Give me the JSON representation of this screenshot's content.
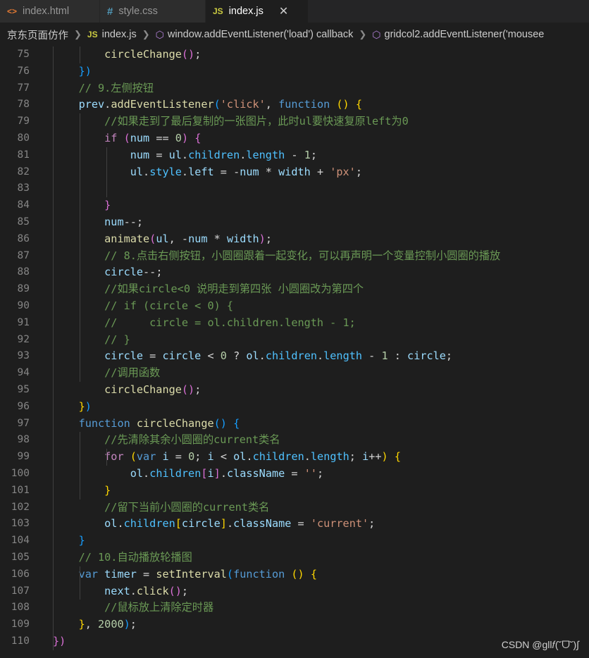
{
  "tabs": [
    {
      "label": "index.html",
      "icon": "html-icon",
      "glyph": "<>"
    },
    {
      "label": "style.css",
      "icon": "css-icon",
      "glyph": "#"
    },
    {
      "label": "index.js",
      "icon": "js-icon",
      "glyph": "JS",
      "active": true,
      "close": "✕"
    }
  ],
  "breadcrumb": {
    "folder": "京东页面仿作",
    "file": "index.js",
    "file_glyph": "JS",
    "sym1": "window.addEventListener('load') callback",
    "sym2": "gridcol2.addEventListener('mousee"
  },
  "colors": {
    "keyword": "#569cd6",
    "control": "#c586c0",
    "function": "#dcdcaa",
    "variable": "#9cdcfe",
    "string": "#ce9178",
    "number": "#b5cea8",
    "comment": "#6a9955"
  },
  "code_lines": [
    {
      "n": "75",
      "tokens": [
        [
          "        ",
          "p"
        ],
        [
          "circleChange",
          "fn"
        ],
        [
          "()",
          "b2"
        ],
        [
          ";",
          "p"
        ]
      ]
    },
    {
      "n": "76",
      "tokens": [
        [
          "    ",
          "p"
        ],
        [
          "}",
          "b3"
        ],
        [
          ")",
          "b3"
        ]
      ]
    },
    {
      "n": "77",
      "tokens": [
        [
          "    ",
          "p"
        ],
        [
          "// 9.左侧按钮",
          "cmt"
        ]
      ]
    },
    {
      "n": "78",
      "tokens": [
        [
          "    ",
          "p"
        ],
        [
          "prev",
          "var"
        ],
        [
          ".",
          "p"
        ],
        [
          "addEventListener",
          "fn"
        ],
        [
          "(",
          "b3"
        ],
        [
          "'click'",
          "str"
        ],
        [
          ", ",
          "p"
        ],
        [
          "function",
          "kw"
        ],
        [
          " ",
          "p"
        ],
        [
          "()",
          "b1"
        ],
        [
          " ",
          "p"
        ],
        [
          "{",
          "b1"
        ]
      ]
    },
    {
      "n": "79",
      "tokens": [
        [
          "        ",
          "p"
        ],
        [
          "//如果走到了最后复制的一张图片，此时ul要快速复原left为0",
          "cmt"
        ]
      ]
    },
    {
      "n": "80",
      "tokens": [
        [
          "        ",
          "p"
        ],
        [
          "if",
          "ctl"
        ],
        [
          " ",
          "p"
        ],
        [
          "(",
          "b2"
        ],
        [
          "num",
          "var"
        ],
        [
          " == ",
          "p"
        ],
        [
          "0",
          "num"
        ],
        [
          ")",
          "b2"
        ],
        [
          " ",
          "p"
        ],
        [
          "{",
          "b2"
        ]
      ]
    },
    {
      "n": "81",
      "tokens": [
        [
          "            ",
          "p"
        ],
        [
          "num",
          "var"
        ],
        [
          " = ",
          "p"
        ],
        [
          "ul",
          "var"
        ],
        [
          ".",
          "p"
        ],
        [
          "children",
          "prop"
        ],
        [
          ".",
          "p"
        ],
        [
          "length",
          "prop"
        ],
        [
          " - ",
          "p"
        ],
        [
          "1",
          "num"
        ],
        [
          ";",
          "p"
        ]
      ]
    },
    {
      "n": "82",
      "tokens": [
        [
          "            ",
          "p"
        ],
        [
          "ul",
          "var"
        ],
        [
          ".",
          "p"
        ],
        [
          "style",
          "prop"
        ],
        [
          ".",
          "p"
        ],
        [
          "left",
          "var"
        ],
        [
          " = -",
          "p"
        ],
        [
          "num",
          "var"
        ],
        [
          " * ",
          "p"
        ],
        [
          "width",
          "var"
        ],
        [
          " + ",
          "p"
        ],
        [
          "'px'",
          "str"
        ],
        [
          ";",
          "p"
        ]
      ]
    },
    {
      "n": "83",
      "tokens": []
    },
    {
      "n": "84",
      "tokens": [
        [
          "        ",
          "p"
        ],
        [
          "}",
          "b2"
        ]
      ]
    },
    {
      "n": "85",
      "tokens": [
        [
          "        ",
          "p"
        ],
        [
          "num",
          "var"
        ],
        [
          "--;",
          "p"
        ]
      ]
    },
    {
      "n": "86",
      "tokens": [
        [
          "        ",
          "p"
        ],
        [
          "animate",
          "fn"
        ],
        [
          "(",
          "b2"
        ],
        [
          "ul",
          "var"
        ],
        [
          ", -",
          "p"
        ],
        [
          "num",
          "var"
        ],
        [
          " * ",
          "p"
        ],
        [
          "width",
          "var"
        ],
        [
          ")",
          "b2"
        ],
        [
          ";",
          "p"
        ]
      ]
    },
    {
      "n": "87",
      "tokens": [
        [
          "        ",
          "p"
        ],
        [
          "// 8.点击右侧按钮，小圆圈跟着一起变化，可以再声明一个变量控制小圆圈的播放",
          "cmt"
        ]
      ]
    },
    {
      "n": "88",
      "tokens": [
        [
          "        ",
          "p"
        ],
        [
          "circle",
          "var"
        ],
        [
          "--;",
          "p"
        ]
      ]
    },
    {
      "n": "89",
      "tokens": [
        [
          "        ",
          "p"
        ],
        [
          "//如果circle<0 说明走到第四张 小圆圈改为第四个",
          "cmt"
        ]
      ]
    },
    {
      "n": "90",
      "tokens": [
        [
          "        ",
          "p"
        ],
        [
          "// if (circle < 0) {",
          "cmt"
        ]
      ]
    },
    {
      "n": "91",
      "tokens": [
        [
          "        ",
          "p"
        ],
        [
          "//     circle = ol.children.length - 1;",
          "cmt"
        ]
      ]
    },
    {
      "n": "92",
      "tokens": [
        [
          "        ",
          "p"
        ],
        [
          "// }",
          "cmt"
        ]
      ]
    },
    {
      "n": "93",
      "tokens": [
        [
          "        ",
          "p"
        ],
        [
          "circle",
          "var"
        ],
        [
          " = ",
          "p"
        ],
        [
          "circle",
          "var"
        ],
        [
          " < ",
          "p"
        ],
        [
          "0",
          "num"
        ],
        [
          " ? ",
          "p"
        ],
        [
          "ol",
          "var"
        ],
        [
          ".",
          "p"
        ],
        [
          "children",
          "prop"
        ],
        [
          ".",
          "p"
        ],
        [
          "length",
          "prop"
        ],
        [
          " - ",
          "p"
        ],
        [
          "1",
          "num"
        ],
        [
          " : ",
          "p"
        ],
        [
          "circle",
          "var"
        ],
        [
          ";",
          "p"
        ]
      ]
    },
    {
      "n": "94",
      "tokens": [
        [
          "        ",
          "p"
        ],
        [
          "//调用函数",
          "cmt"
        ]
      ]
    },
    {
      "n": "95",
      "tokens": [
        [
          "        ",
          "p"
        ],
        [
          "circleChange",
          "fn"
        ],
        [
          "()",
          "b2"
        ],
        [
          ";",
          "p"
        ]
      ]
    },
    {
      "n": "96",
      "tokens": [
        [
          "    ",
          "p"
        ],
        [
          "}",
          "b1"
        ],
        [
          ")",
          "b3"
        ]
      ]
    },
    {
      "n": "97",
      "tokens": [
        [
          "    ",
          "p"
        ],
        [
          "function",
          "kw"
        ],
        [
          " ",
          "p"
        ],
        [
          "circleChange",
          "fn"
        ],
        [
          "()",
          "b3"
        ],
        [
          " ",
          "p"
        ],
        [
          "{",
          "b3"
        ]
      ]
    },
    {
      "n": "98",
      "tokens": [
        [
          "        ",
          "p"
        ],
        [
          "//先清除其余小圆圈的current类名",
          "cmt"
        ]
      ]
    },
    {
      "n": "99",
      "tokens": [
        [
          "        ",
          "p"
        ],
        [
          "for",
          "ctl"
        ],
        [
          " ",
          "p"
        ],
        [
          "(",
          "b1"
        ],
        [
          "var",
          "kw"
        ],
        [
          " ",
          "p"
        ],
        [
          "i",
          "var"
        ],
        [
          " = ",
          "p"
        ],
        [
          "0",
          "num"
        ],
        [
          "; ",
          "p"
        ],
        [
          "i",
          "var"
        ],
        [
          " < ",
          "p"
        ],
        [
          "ol",
          "var"
        ],
        [
          ".",
          "p"
        ],
        [
          "children",
          "prop"
        ],
        [
          ".",
          "p"
        ],
        [
          "length",
          "prop"
        ],
        [
          "; ",
          "p"
        ],
        [
          "i",
          "var"
        ],
        [
          "++",
          "p"
        ],
        [
          ")",
          "b1"
        ],
        [
          " ",
          "p"
        ],
        [
          "{",
          "b1"
        ]
      ]
    },
    {
      "n": "100",
      "tokens": [
        [
          "            ",
          "p"
        ],
        [
          "ol",
          "var"
        ],
        [
          ".",
          "p"
        ],
        [
          "children",
          "prop"
        ],
        [
          "[",
          "b2"
        ],
        [
          "i",
          "var"
        ],
        [
          "]",
          "b2"
        ],
        [
          ".",
          "p"
        ],
        [
          "className",
          "var"
        ],
        [
          " = ",
          "p"
        ],
        [
          "''",
          "str"
        ],
        [
          ";",
          "p"
        ]
      ]
    },
    {
      "n": "101",
      "tokens": [
        [
          "        ",
          "p"
        ],
        [
          "}",
          "b1"
        ]
      ]
    },
    {
      "n": "102",
      "tokens": [
        [
          "        ",
          "p"
        ],
        [
          "//留下当前小圆圈的current类名",
          "cmt"
        ]
      ]
    },
    {
      "n": "103",
      "tokens": [
        [
          "        ",
          "p"
        ],
        [
          "ol",
          "var"
        ],
        [
          ".",
          "p"
        ],
        [
          "children",
          "prop"
        ],
        [
          "[",
          "b1"
        ],
        [
          "circle",
          "var"
        ],
        [
          "]",
          "b1"
        ],
        [
          ".",
          "p"
        ],
        [
          "className",
          "var"
        ],
        [
          " = ",
          "p"
        ],
        [
          "'current'",
          "str"
        ],
        [
          ";",
          "p"
        ]
      ]
    },
    {
      "n": "104",
      "tokens": [
        [
          "    ",
          "p"
        ],
        [
          "}",
          "b3"
        ]
      ]
    },
    {
      "n": "105",
      "tokens": [
        [
          "    ",
          "p"
        ],
        [
          "// 10.自动播放轮播图",
          "cmt"
        ]
      ]
    },
    {
      "n": "106",
      "tokens": [
        [
          "    ",
          "p"
        ],
        [
          "var",
          "kw"
        ],
        [
          " ",
          "p"
        ],
        [
          "timer",
          "var"
        ],
        [
          " = ",
          "p"
        ],
        [
          "setInterval",
          "fn"
        ],
        [
          "(",
          "b3"
        ],
        [
          "function",
          "kw"
        ],
        [
          " ",
          "p"
        ],
        [
          "()",
          "b1"
        ],
        [
          " ",
          "p"
        ],
        [
          "{",
          "b1"
        ]
      ]
    },
    {
      "n": "107",
      "tokens": [
        [
          "        ",
          "p"
        ],
        [
          "next",
          "var"
        ],
        [
          ".",
          "p"
        ],
        [
          "click",
          "fn"
        ],
        [
          "()",
          "b2"
        ],
        [
          ";",
          "p"
        ]
      ]
    },
    {
      "n": "108",
      "tokens": [
        [
          "        ",
          "p"
        ],
        [
          "//鼠标放上清除定时器",
          "cmt"
        ]
      ]
    },
    {
      "n": "109",
      "tokens": [
        [
          "    ",
          "p"
        ],
        [
          "}",
          "b1"
        ],
        [
          ", ",
          "p"
        ],
        [
          "2000",
          "num"
        ],
        [
          ")",
          "b3"
        ],
        [
          ";",
          "p"
        ]
      ]
    },
    {
      "n": "110",
      "tokens": [
        [
          "",
          "p"
        ],
        [
          "})",
          "b2"
        ]
      ]
    }
  ],
  "watermark": "CSDN @gll𝑓(˘ᗜ˘)∫"
}
